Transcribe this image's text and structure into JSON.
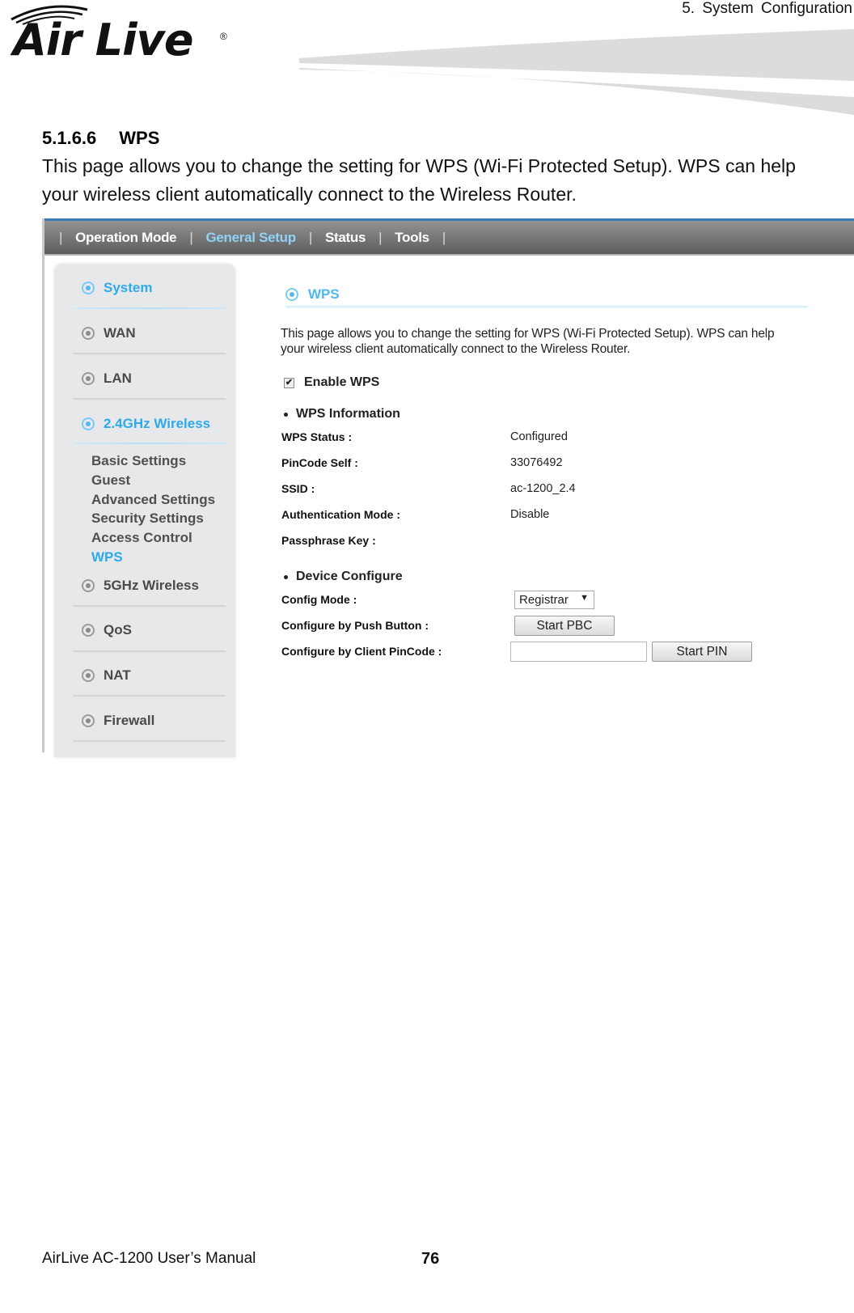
{
  "header": {
    "logo_text": "Air Live",
    "logo_reg": "®",
    "chapter": "5.  System  Configuration"
  },
  "section": {
    "number": "5.1.6.6",
    "title": "WPS",
    "intro_line1": "This page allows you to change the setting for WPS (Wi-Fi Protected Setup). WPS can help",
    "intro_line2": "your wireless client automatically connect to the Wireless Router."
  },
  "router_ui": {
    "top_nav": [
      {
        "label": "Operation Mode",
        "active": false
      },
      {
        "label": "General Setup",
        "active": true
      },
      {
        "label": "Status",
        "active": false
      },
      {
        "label": "Tools",
        "active": false
      }
    ],
    "nav_separator": "|",
    "sidebar": {
      "items": [
        {
          "label": "System",
          "active": true
        },
        {
          "label": "WAN",
          "active": false
        },
        {
          "label": "LAN",
          "active": false
        },
        {
          "label": "2.4GHz Wireless",
          "active": true
        },
        {
          "label": "5GHz Wireless",
          "active": false
        },
        {
          "label": "QoS",
          "active": false
        },
        {
          "label": "NAT",
          "active": false
        },
        {
          "label": "Firewall",
          "active": false
        }
      ],
      "sub_items": [
        {
          "label": "Basic Settings",
          "active": false
        },
        {
          "label": "Guest",
          "active": false
        },
        {
          "label": "Advanced Settings",
          "active": false
        },
        {
          "label": "Security Settings",
          "active": false
        },
        {
          "label": "Access Control",
          "active": false
        },
        {
          "label": "WPS",
          "active": true
        }
      ]
    },
    "pane": {
      "title": "WPS",
      "desc_line1": "This page allows you to change the setting for WPS (Wi-Fi Protected Setup). WPS can help",
      "desc_line2": "your wireless client automatically connect to the Wireless Router.",
      "enable_label": "Enable WPS",
      "enable_checked": true,
      "info_heading": "WPS Information",
      "info_rows": [
        {
          "label": "WPS Status :",
          "value": "Configured"
        },
        {
          "label": "PinCode Self :",
          "value": "33076492"
        },
        {
          "label": "SSID :",
          "value": "ac-1200_2.4"
        },
        {
          "label": "Authentication Mode :",
          "value": "Disable"
        },
        {
          "label": "Passphrase Key :",
          "value": ""
        }
      ],
      "device_heading": "Device Configure",
      "config_mode_label": "Config Mode :",
      "config_mode_value": "Registrar",
      "push_button_label": "Configure by Push Button :",
      "start_pbc": "Start PBC",
      "client_pin_label": "Configure by Client PinCode :",
      "client_pin_value": "",
      "start_pin": "Start PIN"
    }
  },
  "footer": {
    "manual": "AirLive AC-1200 User’s Manual",
    "page": "76"
  },
  "colors": {
    "accent_blue": "#2eaae8",
    "nav_active": "#8fd3f5",
    "nav_top_border": "#3a7ab8"
  }
}
